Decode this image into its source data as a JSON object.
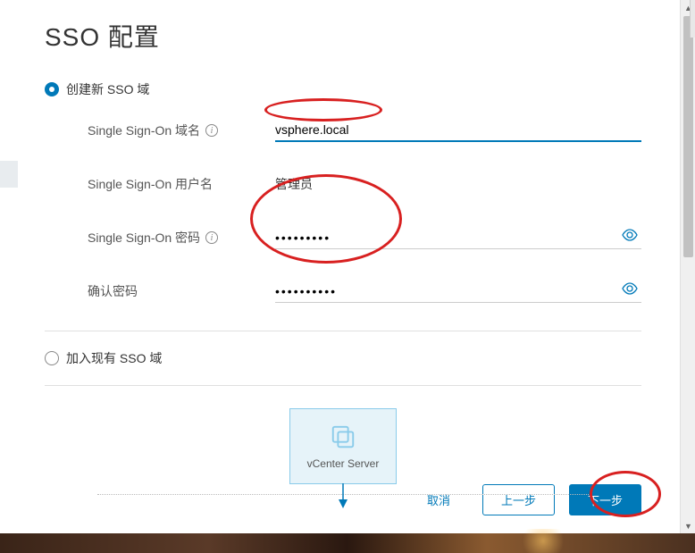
{
  "page": {
    "title": "SSO 配置"
  },
  "options": {
    "create_new": {
      "label": "创建新 SSO 域",
      "selected": true
    },
    "join_existing": {
      "label": "加入现有 SSO 域",
      "selected": false
    }
  },
  "form": {
    "domain": {
      "label": "Single Sign-On 域名",
      "value": "vsphere.local"
    },
    "username": {
      "label": "Single Sign-On 用户名",
      "value": "管理员"
    },
    "password": {
      "label": "Single Sign-On 密码",
      "value": "•••••••••"
    },
    "confirm": {
      "label": "确认密码",
      "value": "••••••••••"
    }
  },
  "diagram": {
    "vcenter_label": "vCenter Server"
  },
  "buttons": {
    "cancel": "取消",
    "previous": "上一步",
    "next": "下一步"
  }
}
